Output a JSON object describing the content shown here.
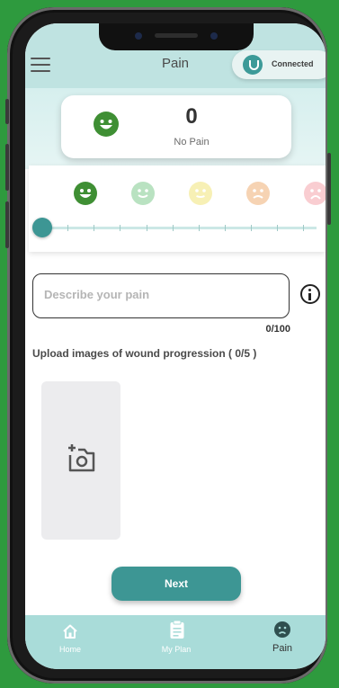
{
  "header": {
    "title": "Pain",
    "connection_status": "Connected"
  },
  "score": {
    "value": "0",
    "label": "No Pain"
  },
  "scale": {
    "level": 0,
    "faces": [
      {
        "name": "very-happy-face-icon",
        "color": "#3f8f34"
      },
      {
        "name": "happy-face-icon",
        "color": "#b9e2c1"
      },
      {
        "name": "neutral-face-icon",
        "color": "#f7f0b5"
      },
      {
        "name": "sad-face-icon",
        "color": "#f6d3b3"
      },
      {
        "name": "very-sad-face-icon",
        "color": "#f9cdd1"
      }
    ]
  },
  "description": {
    "placeholder": "Describe your pain",
    "char_count": "0/100"
  },
  "upload": {
    "label": "Upload images of wound progression ( 0/5 )"
  },
  "actions": {
    "next_label": "Next"
  },
  "nav": {
    "items": [
      {
        "label": "Home",
        "icon": "home-icon",
        "active": false
      },
      {
        "label": "My Plan",
        "icon": "clipboard-icon",
        "active": false
      },
      {
        "label": "Pain",
        "icon": "pain-face-icon",
        "active": true
      }
    ]
  },
  "colors": {
    "accent": "#3d9694",
    "header_bg": "#bfe3e1",
    "nav_bg": "#a9dcd9",
    "background": "#2e9a3e"
  }
}
